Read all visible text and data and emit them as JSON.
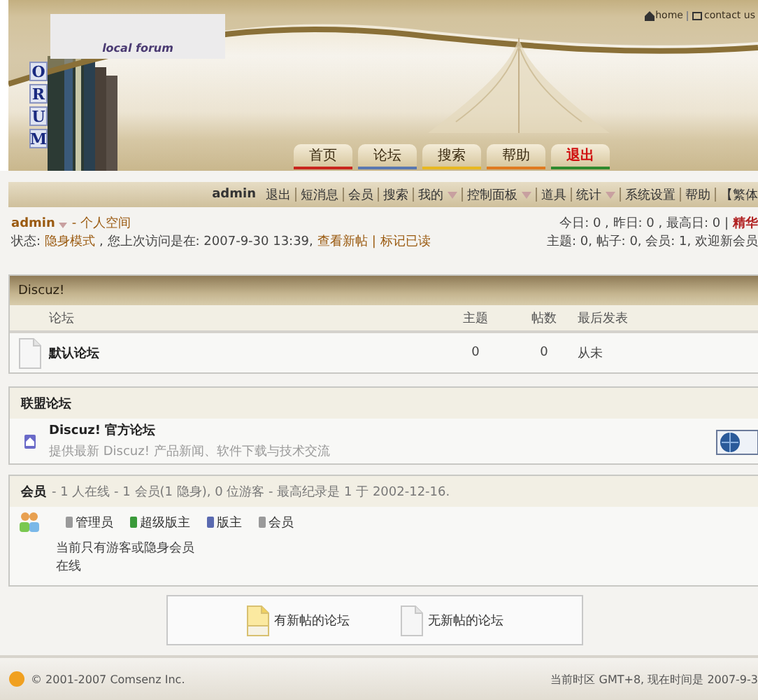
{
  "header": {
    "top_links": [
      "home",
      "contact us"
    ],
    "logo_subtitle": "local forum",
    "logo_letters": [
      "O",
      "R",
      "U",
      "M"
    ],
    "nav_tabs": [
      {
        "label": "首页",
        "color": "#c8261e",
        "highlight": false
      },
      {
        "label": "论坛",
        "color": "#5a78b0",
        "highlight": false
      },
      {
        "label": "搜索",
        "color": "#e8b820",
        "highlight": false
      },
      {
        "label": "帮助",
        "color": "#e07a20",
        "highlight": false
      },
      {
        "label": "退出",
        "color": "#2e8a2e",
        "highlight": true
      }
    ]
  },
  "menu": {
    "user": "admin",
    "items": [
      {
        "label": "退出",
        "dropdown": false
      },
      {
        "label": "短消息",
        "dropdown": false
      },
      {
        "label": "会员",
        "dropdown": false
      },
      {
        "label": "搜索",
        "dropdown": false
      },
      {
        "label": "我的",
        "dropdown": true
      },
      {
        "label": "控制面板",
        "dropdown": true
      },
      {
        "label": "道具",
        "dropdown": false
      },
      {
        "label": "统计",
        "dropdown": true
      },
      {
        "label": "系统设置",
        "dropdown": false
      },
      {
        "label": "帮助",
        "dropdown": false
      },
      {
        "label": "【繁体",
        "dropdown": false
      }
    ]
  },
  "user_info": {
    "name": "admin",
    "space_link": "- 个人空间",
    "status_label": "状态:",
    "status_value": "隐身模式",
    "last_visit": ", 您上次访问是在: 2007-9-30 13:39,",
    "new_posts_link": "查看新帖",
    "mark_read_link": "| 标记已读",
    "stats": [
      "今日: 0 , 昨日: 0 , 最高日: 0 |",
      "主题: 0, 帖子: 0, 会员: 1, 欢迎新会员"
    ],
    "digest_link": "精华"
  },
  "forum_category": {
    "title": "Discuz!",
    "columns": [
      "论坛",
      "主题",
      "帖数",
      "最后发表"
    ],
    "rows": [
      {
        "name": "默认论坛",
        "topics": "0",
        "posts": "0",
        "last_post": "从未",
        "has_new": false
      }
    ]
  },
  "partner_forums": {
    "title": "联盟论坛",
    "items": [
      {
        "name": "Discuz! 官方论坛",
        "description": "提供最新 Discuz! 产品新闻、软件下载与技术交流"
      }
    ]
  },
  "members": {
    "title": "会员",
    "summary": "- 1 人在线 - 1 会员(1 隐身), 0 位游客 - 最高纪录是 1 于 2002-12-16.",
    "groups": [
      {
        "label": "管理员",
        "color": "#9a9a9a"
      },
      {
        "label": "超级版主",
        "color": "#3a9a3a"
      },
      {
        "label": "版主",
        "color": "#5a6ab0"
      },
      {
        "label": "会员",
        "color": "#9a9a9a"
      }
    ],
    "message": "当前只有游客或隐身会员在线"
  },
  "legend": [
    {
      "label": "有新帖的论坛",
      "has_new": true
    },
    {
      "label": "无新帖的论坛",
      "has_new": false
    }
  ],
  "footer": {
    "copyright": "© 2001-2007 Comsenz Inc.",
    "timezone": "当前时区 GMT+8, 现在时间是 2007-9-3"
  }
}
